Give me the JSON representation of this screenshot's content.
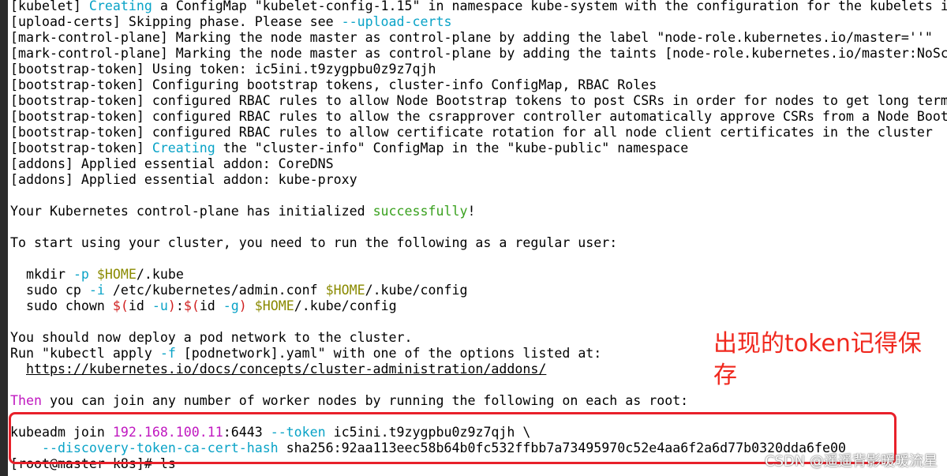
{
  "terminal": {
    "lines": [
      [
        {
          "t": "[kubelet] "
        },
        {
          "t": "Creating",
          "c": "cyan"
        },
        {
          "t": " a ConfigMap \"kubelet-config-1.15\" in namespace kube-system with the configuration for the kubelets i"
        }
      ],
      [
        {
          "t": "[upload-certs] Skipping phase. Please see "
        },
        {
          "t": "--upload-certs",
          "c": "cyan"
        }
      ],
      [
        {
          "t": "[mark-control-plane] Marking the node master as control-plane by adding the label \"node-role.kubernetes.io/master=''\""
        }
      ],
      [
        {
          "t": "[mark-control-plane] Marking the node master as control-plane by adding the taints [node-role.kubernetes.io/master:NoSc"
        }
      ],
      [
        {
          "t": "[bootstrap-token] Using token: ic5ini.t9zygpbu0z9z7qjh"
        }
      ],
      [
        {
          "t": "[bootstrap-token] Configuring bootstrap tokens, cluster-info ConfigMap, RBAC Roles"
        }
      ],
      [
        {
          "t": "[bootstrap-token] configured RBAC rules to allow Node Bootstrap tokens to post CSRs in order for nodes to get long term"
        }
      ],
      [
        {
          "t": "[bootstrap-token] configured RBAC rules to allow the csrapprover controller automatically approve CSRs from a Node Boot"
        }
      ],
      [
        {
          "t": "[bootstrap-token] configured RBAC rules to allow certificate rotation for all node client certificates in the cluster"
        }
      ],
      [
        {
          "t": "[bootstrap-token] "
        },
        {
          "t": "Creating",
          "c": "cyan"
        },
        {
          "t": " the \"cluster-info\" ConfigMap in the \"kube-public\" namespace"
        }
      ],
      [
        {
          "t": "[addons] Applied essential addon: CoreDNS"
        }
      ],
      [
        {
          "t": "[addons] Applied essential addon: kube-proxy"
        }
      ],
      [],
      [
        {
          "t": "Your Kubernetes control-plane has initialized "
        },
        {
          "t": "successfully",
          "c": "green"
        },
        {
          "t": "!"
        }
      ],
      [],
      [
        {
          "t": "To start using your cluster, you need to run the following as a regular user:"
        }
      ],
      [],
      [
        {
          "t": "  mkdir "
        },
        {
          "t": "-p",
          "c": "cyan"
        },
        {
          "t": " "
        },
        {
          "t": "$HOME",
          "c": "olive"
        },
        {
          "t": "/.kube"
        }
      ],
      [
        {
          "t": "  sudo cp "
        },
        {
          "t": "-i",
          "c": "cyan"
        },
        {
          "t": " /etc/kubernetes/admin.conf "
        },
        {
          "t": "$HOME",
          "c": "olive"
        },
        {
          "t": "/.kube/config"
        }
      ],
      [
        {
          "t": "  sudo chown "
        },
        {
          "t": "$(",
          "c": "red"
        },
        {
          "t": "id "
        },
        {
          "t": "-u",
          "c": "cyan"
        },
        {
          "t": ")",
          "c": "red"
        },
        {
          "t": ":"
        },
        {
          "t": "$(",
          "c": "red"
        },
        {
          "t": "id "
        },
        {
          "t": "-g",
          "c": "cyan"
        },
        {
          "t": ")",
          "c": "red"
        },
        {
          "t": " "
        },
        {
          "t": "$HOME",
          "c": "olive"
        },
        {
          "t": "/.kube/config"
        }
      ],
      [],
      [
        {
          "t": "You should now deploy a pod network to the cluster."
        }
      ],
      [
        {
          "t": "Run \"kubectl apply "
        },
        {
          "t": "-f",
          "c": "cyan"
        },
        {
          "t": " [podnetwork].yaml\" with one of the options listed at:"
        }
      ],
      [
        {
          "t": "  "
        },
        {
          "t": "https://kubernetes.io/docs/concepts/cluster-administration/addons/",
          "u": true
        }
      ],
      [],
      [
        {
          "t": "Then",
          "c": "magenta"
        },
        {
          "t": " you can join any number of worker nodes by running the following on each as root:"
        }
      ],
      [],
      [
        {
          "t": "kubeadm join "
        },
        {
          "t": "192.168.100.11",
          "c": "magenta"
        },
        {
          "t": ":6443 "
        },
        {
          "t": "--token",
          "c": "cyan"
        },
        {
          "t": " ic5ini.t9zygpbu0z9z7qjh \\"
        }
      ],
      [
        {
          "t": "    "
        },
        {
          "t": "--discovery-token-ca-cert-hash",
          "c": "cyan"
        },
        {
          "t": " sha256:92aa113eec58b64b0fc532ffbb7a73495970c52e4aa6f2a6d77b0320dda6fe00"
        }
      ],
      [
        {
          "t": "[root@master k8s]# ls"
        }
      ]
    ]
  },
  "annotation": {
    "text": "出现的token记得保存"
  },
  "watermark": {
    "text": "CSDN @遥遥背影暖暖流星"
  },
  "colors": {
    "cyan": "#0aa3c7",
    "magenta": "#c018c0",
    "green": "#3aa11f",
    "olive": "#8a8a00",
    "red": "#d02020",
    "highlight_box": "#e8202a",
    "annotation": "#f0281e"
  }
}
